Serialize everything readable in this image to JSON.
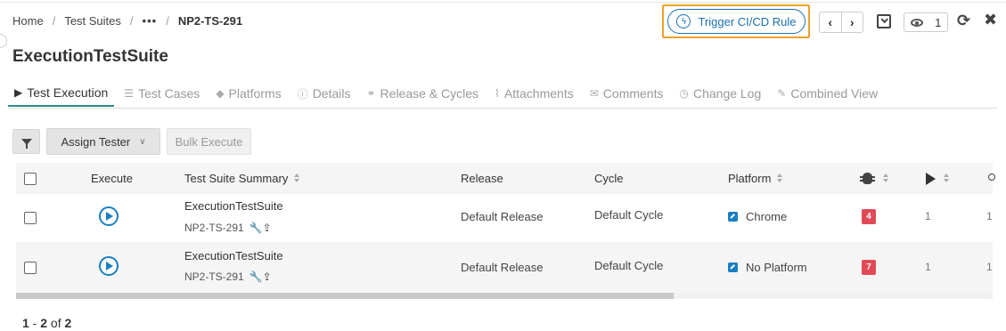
{
  "breadcrumb": {
    "home": "Home",
    "suites": "Test Suites",
    "ellipsis": "•••",
    "current": "NP2-TS-291"
  },
  "header": {
    "cicd_label": "Trigger CI/CD Rule",
    "prev_icon": "chevron-left-icon",
    "next_icon": "chevron-right-icon",
    "watch_count": "1",
    "refresh_glyph": "⟳",
    "close_glyph": "✖",
    "nav_prev_glyph": "‹",
    "nav_next_glyph": "›",
    "accent_color": "#1a6fb3",
    "highlight_color": "#f0a030"
  },
  "page_title": "ExecutionTestSuite",
  "tabs": [
    {
      "label": "Test Execution",
      "icon": "play-circle-icon",
      "glyph": "▶",
      "active": true
    },
    {
      "label": "Test Cases",
      "icon": "document-icon",
      "glyph": "☰"
    },
    {
      "label": "Platforms",
      "icon": "cubes-icon",
      "glyph": "◆"
    },
    {
      "label": "Details",
      "icon": "info-icon",
      "glyph": "ⓘ"
    },
    {
      "label": "Release & Cycles",
      "icon": "link-icon",
      "glyph": "⚭"
    },
    {
      "label": "Attachments",
      "icon": "paperclip-icon",
      "glyph": "⌇"
    },
    {
      "label": "Comments",
      "icon": "comments-icon",
      "glyph": "✉"
    },
    {
      "label": "Change Log",
      "icon": "clock-icon",
      "glyph": "◷"
    },
    {
      "label": "Combined View",
      "icon": "pencil-icon",
      "glyph": "✎"
    }
  ],
  "toolbar": {
    "assign_label": "Assign Tester",
    "assign_chevron": "∨",
    "bulk_label": "Bulk Execute"
  },
  "table": {
    "headers": {
      "execute": "Execute",
      "summary": "Test Suite Summary",
      "release": "Release",
      "cycle": "Cycle",
      "platform": "Platform"
    },
    "rows": [
      {
        "title": "ExecutionTestSuite",
        "key": "NP2-TS-291",
        "tools": "🔧⇪",
        "release": "Default Release",
        "cycle": "Default Cycle",
        "platform": "Chrome",
        "defects": "4",
        "runs": "1",
        "assignee": "1"
      },
      {
        "title": "ExecutionTestSuite",
        "key": "NP2-TS-291",
        "tools": "🔧⇪",
        "release": "Default Release",
        "cycle": "Default Cycle",
        "platform": "No Platform",
        "defects": "7",
        "runs": "1",
        "assignee": "1"
      }
    ]
  },
  "pager": {
    "from": "1",
    "dash": " - ",
    "to": "2",
    "of": " of ",
    "total": "2"
  }
}
